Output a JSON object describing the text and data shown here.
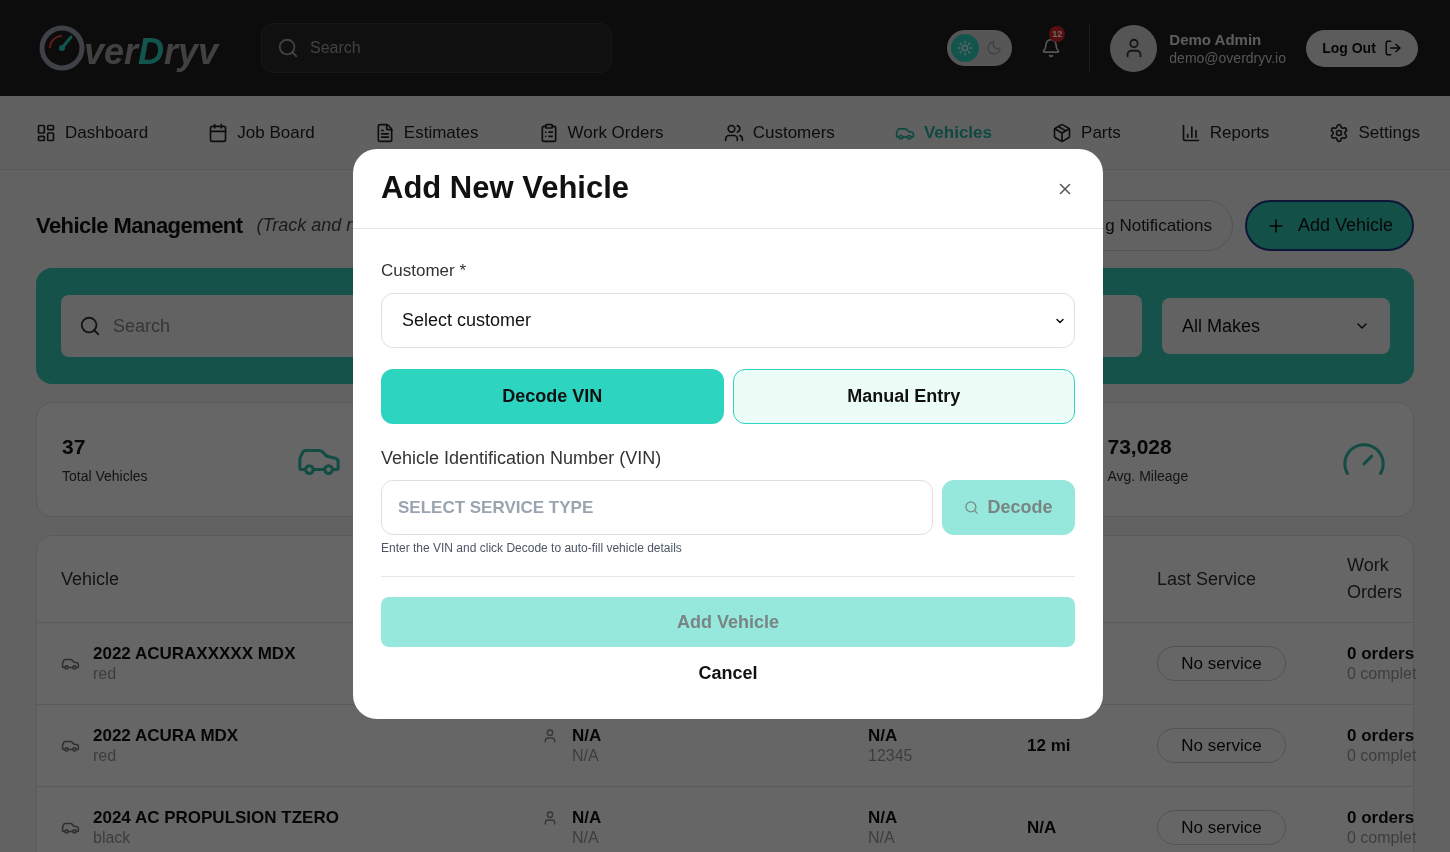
{
  "header": {
    "logo": {
      "parts": [
        {
          "text": "ver",
          "accent": false
        },
        {
          "text": "D",
          "accent": true
        },
        {
          "text": "ryv",
          "accent": false
        }
      ]
    },
    "search": {
      "placeholder": "Search"
    },
    "theme_toggle": {
      "dark": false
    },
    "notifications": {
      "count": "12"
    },
    "user": {
      "name": "Demo Admin",
      "email": "demo@overdryv.io"
    },
    "logout_button": "Log Out"
  },
  "nav": [
    {
      "label": "Dashboard",
      "selected": false
    },
    {
      "label": "Job Board",
      "selected": false
    },
    {
      "label": "Estimates",
      "selected": false
    },
    {
      "label": "Work Orders",
      "selected": false
    },
    {
      "label": "Customers",
      "selected": false
    },
    {
      "label": "Vehicles",
      "selected": true
    },
    {
      "label": "Parts",
      "selected": false
    },
    {
      "label": "Reports",
      "selected": false
    },
    {
      "label": "Settings",
      "selected": false
    }
  ],
  "page": {
    "title": "Vehicle Management",
    "subtitle": "(Track and r",
    "notifications_button": "g Notifications",
    "add_button": "Add Vehicle"
  },
  "filters": {
    "search": {
      "placeholder": "Search"
    },
    "make_select": {
      "value": "All Makes"
    }
  },
  "stats": [
    {
      "kind": "vehicles",
      "value": "37",
      "label": "Total Vehicles"
    },
    {
      "kind": "mileage",
      "value": "73,028",
      "label": "Avg. Mileage"
    }
  ],
  "table": {
    "columns": {
      "vehicle": "Vehicle",
      "last_service": "Last Service",
      "work_orders": "Work Orders"
    },
    "rows": [
      {
        "vehicle": "2022 ACURAXXXXX MDX",
        "vehicle_color": "red",
        "last_service": "No service",
        "orders": "0 orders",
        "orders_completed": "0 complet"
      },
      {
        "vehicle": "2022 ACURA MDX",
        "vehicle_color": "red",
        "customer": "N/A",
        "customer_sub": "N/A",
        "column_3": "N/A",
        "column_3_sub": "12345",
        "mileage": "12 mi",
        "last_service": "No service",
        "orders": "0 orders",
        "orders_completed": "0 complet"
      },
      {
        "vehicle": "2024 AC PROPULSION TZERO",
        "vehicle_color": "black",
        "customer": "N/A",
        "customer_sub": "N/A",
        "column_3": "N/A",
        "column_3_sub": "N/A",
        "mileage": "N/A",
        "last_service": "No service",
        "orders": "0 orders",
        "orders_completed": "0 complet"
      }
    ]
  },
  "modal": {
    "title": "Add New Vehicle",
    "customer_label": "Customer *",
    "customer_select": {
      "value": "Select customer"
    },
    "modes": [
      {
        "label": "Decode VIN",
        "selected": true
      },
      {
        "label": "Manual Entry",
        "selected": false
      }
    ],
    "vin_label": "Vehicle Identification Number (VIN)",
    "vin_input": {
      "placeholder": "SELECT SERVICE TYPE"
    },
    "decode_button": {
      "label": "Decode",
      "disabled": true
    },
    "hint": "Enter the VIN and click Decode to auto-fill vehicle details",
    "submit_button": {
      "label": "Add Vehicle",
      "disabled": true
    },
    "cancel_button": "Cancel"
  }
}
